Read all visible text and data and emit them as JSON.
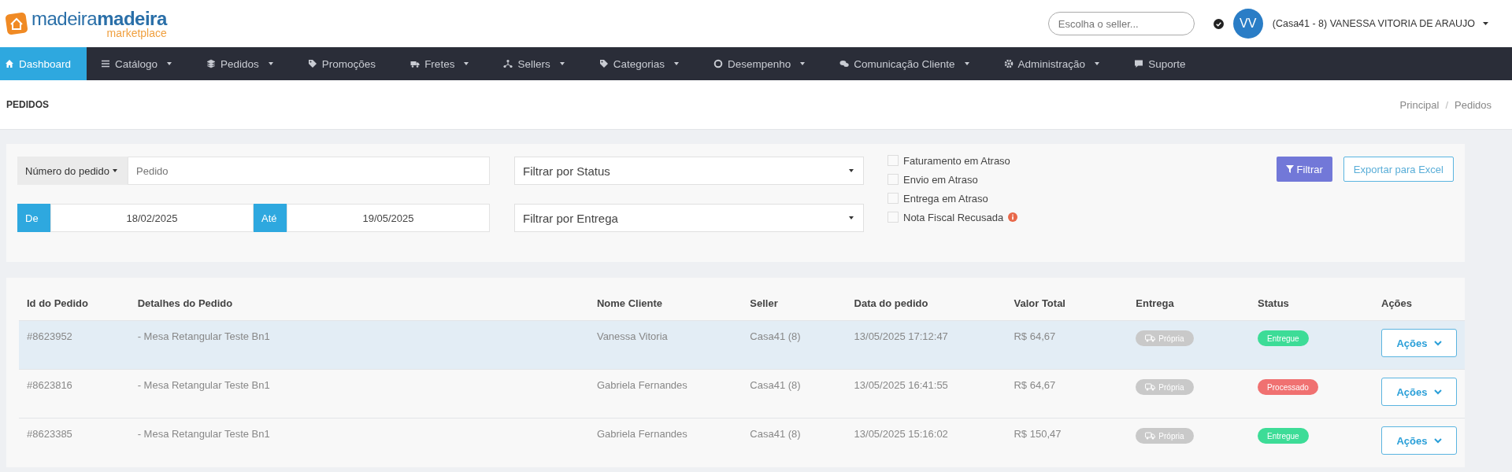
{
  "brand": {
    "name_light": "madeira",
    "name_bold": "madeira",
    "sub": "marketplace"
  },
  "topbar": {
    "seller_search": {
      "placeholder": "Escolha o seller..."
    },
    "avatar_initials": "VV",
    "user": "(Casa41 - 8) VANESSA VITORIA DE ARAUJO"
  },
  "nav": [
    {
      "label": "Dashboard",
      "selected": true,
      "caret": false
    },
    {
      "label": "Catálogo",
      "selected": false,
      "caret": true
    },
    {
      "label": "Pedidos",
      "selected": false,
      "caret": true
    },
    {
      "label": "Promoções",
      "selected": false,
      "caret": false
    },
    {
      "label": "Fretes",
      "selected": false,
      "caret": true
    },
    {
      "label": "Sellers",
      "selected": false,
      "caret": true
    },
    {
      "label": "Categorias",
      "selected": false,
      "caret": true
    },
    {
      "label": "Desempenho",
      "selected": false,
      "caret": true
    },
    {
      "label": "Comunicação Cliente",
      "selected": false,
      "caret": true
    },
    {
      "label": "Administração",
      "selected": false,
      "caret": true
    },
    {
      "label": "Suporte",
      "selected": false,
      "caret": false
    }
  ],
  "page": {
    "title": "PEDIDOS",
    "breadcrumb": [
      "Principal",
      "Pedidos"
    ],
    "breadcrumb_separator": "/"
  },
  "filters": {
    "order_type": "Número do pedido",
    "order_placeholder": "Pedido",
    "from_label": "De",
    "from": "18/02/2025",
    "to_label": "Até",
    "to": "19/05/2025",
    "status_select": "Filtrar por Status",
    "delivery_select": "Filtrar por Entrega",
    "checks": [
      {
        "label": "Faturamento em Atraso",
        "checked": false,
        "info": false
      },
      {
        "label": "Envio em Atraso",
        "checked": false,
        "info": false
      },
      {
        "label": "Entrega em Atraso",
        "checked": false,
        "info": false
      },
      {
        "label": "Nota Fiscal Recusada",
        "checked": false,
        "info": true
      }
    ],
    "filter_button": "Filtrar",
    "export_button": "Exportar para Excel"
  },
  "table": {
    "columns": [
      "Id do Pedido",
      "Detalhes do Pedido",
      "Nome Cliente",
      "Seller",
      "Data do pedido",
      "Valor Total",
      "Entrega",
      "Status",
      "Ações"
    ],
    "rows": [
      {
        "id": "#8623952",
        "details": "- Mesa Retangular Teste Bn1",
        "client": "Vanessa Vitoria",
        "seller": "Casa41 (8)",
        "date": "13/05/2025 17:12:47",
        "total": "R$ 64,67",
        "delivery": "Própria",
        "status": "Entregue",
        "color": "#3ddc97",
        "actions": "Ações",
        "selected": true
      },
      {
        "id": "#8623816",
        "details": "- Mesa Retangular Teste Bn1",
        "client": "Gabriela Fernandes",
        "seller": "Casa41 (8)",
        "date": "13/05/2025 16:41:55",
        "total": "R$ 64,67",
        "delivery": "Própria",
        "status": "Processado",
        "color": "#f07171",
        "actions": "Ações",
        "selected": false
      },
      {
        "id": "#8623385",
        "details": "- Mesa Retangular Teste Bn1",
        "client": "Gabriela Fernandes",
        "seller": "Casa41 (8)",
        "date": "13/05/2025 15:16:02",
        "total": "R$ 150,47",
        "delivery": "Própria",
        "status": "Entregue",
        "color": "#3ddc97",
        "actions": "Ações",
        "selected": false
      }
    ]
  }
}
